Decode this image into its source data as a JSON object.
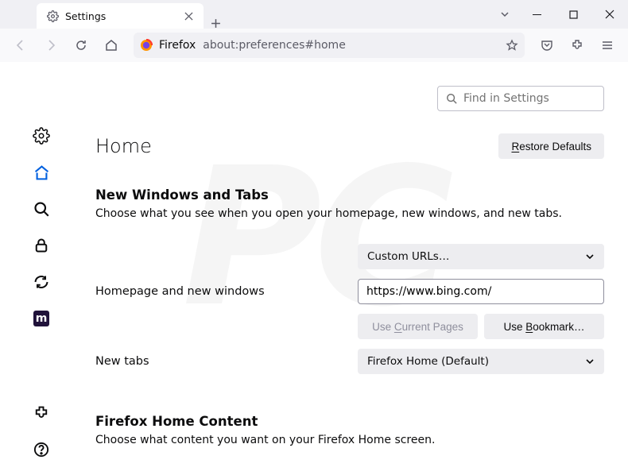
{
  "tab": {
    "title": "Settings"
  },
  "url": {
    "scheme": "Firefox",
    "path": "about:preferences#home"
  },
  "search": {
    "placeholder": "Find in Settings"
  },
  "page": {
    "title": "Home",
    "restore": "Restore Defaults",
    "section1": {
      "heading": "New Windows and Tabs",
      "desc": "Choose what you see when you open your homepage, new windows, and new tabs."
    },
    "homepage": {
      "label": "Homepage and new windows",
      "select": "Custom URLs…",
      "value": "https://www.bing.com/",
      "use_current": "Use Current Pages",
      "use_bookmark": "Use Bookmark…"
    },
    "newtabs": {
      "label": "New tabs",
      "select": "Firefox Home (Default)"
    },
    "section2": {
      "heading": "Firefox Home Content",
      "desc": "Choose what content you want on your Firefox Home screen."
    }
  }
}
